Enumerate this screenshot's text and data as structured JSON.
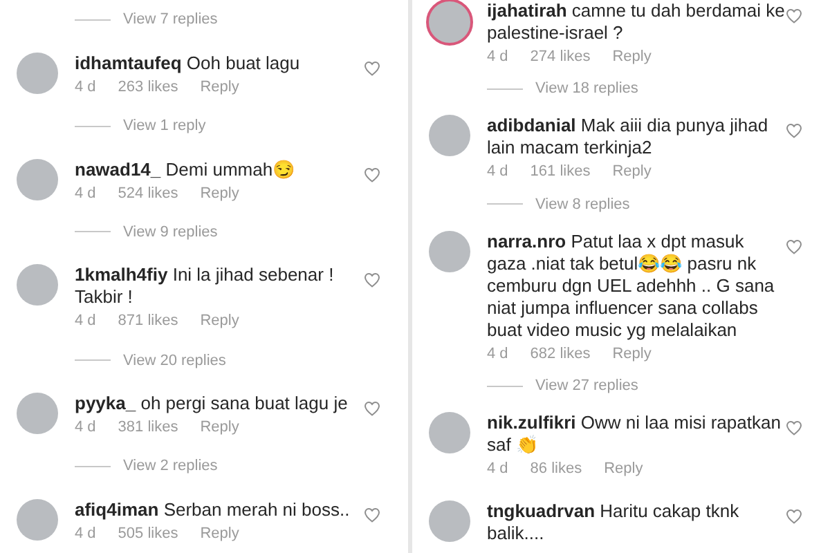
{
  "columns": [
    {
      "items": [
        {
          "kind": "replies",
          "label": "View 7 replies"
        },
        {
          "kind": "comment",
          "username": "idhamtaufeq",
          "text": "Ooh buat lagu",
          "time": "4 d",
          "likes": "263 likes",
          "reply": "Reply",
          "story_ring": false
        },
        {
          "kind": "replies",
          "label": "View 1 reply"
        },
        {
          "kind": "comment",
          "username": "nawad14_",
          "text": "Demi ummah😏",
          "time": "4 d",
          "likes": "524 likes",
          "reply": "Reply",
          "story_ring": false
        },
        {
          "kind": "replies",
          "label": "View 9 replies"
        },
        {
          "kind": "comment",
          "username": "1kmalh4fiy",
          "text": "Ini la jihad sebenar ! Takbir !",
          "time": "4 d",
          "likes": "871 likes",
          "reply": "Reply",
          "story_ring": false
        },
        {
          "kind": "replies",
          "label": "View 20 replies"
        },
        {
          "kind": "comment",
          "username": "pyyka_",
          "text": "oh pergi sana buat lagu je",
          "time": "4 d",
          "likes": "381 likes",
          "reply": "Reply",
          "story_ring": false
        },
        {
          "kind": "replies",
          "label": "View 2 replies"
        },
        {
          "kind": "comment",
          "username": "afiq4iman",
          "text": "Serban merah ni boss..",
          "time": "4 d",
          "likes": "505 likes",
          "reply": "Reply",
          "story_ring": false
        }
      ]
    },
    {
      "items": [
        {
          "kind": "comment",
          "username": "ijahatirah",
          "text": "camne tu dah berdamai ke palestine-israel ?",
          "time": "4 d",
          "likes": "274 likes",
          "reply": "Reply",
          "story_ring": true
        },
        {
          "kind": "replies",
          "label": "View 18 replies"
        },
        {
          "kind": "comment",
          "username": "adibdanial",
          "text": "Mak aiii dia punya jihad lain macam terkinja2",
          "time": "4 d",
          "likes": "161 likes",
          "reply": "Reply",
          "story_ring": false
        },
        {
          "kind": "replies",
          "label": "View 8 replies"
        },
        {
          "kind": "comment",
          "username": "narra.nro",
          "text": "Patut laa x dpt masuk gaza .niat tak betul😂😂 pasru nk cemburu dgn UEL  adehhh .. G sana niat jumpa influencer sana collabs buat video music yg melalaikan",
          "time": "4 d",
          "likes": "682 likes",
          "reply": "Reply",
          "story_ring": false
        },
        {
          "kind": "replies",
          "label": "View 27 replies"
        },
        {
          "kind": "comment",
          "username": "nik.zulfikri",
          "text": "Oww ni laa misi rapatkan saf 👏",
          "time": "4 d",
          "likes": "86 likes",
          "reply": "Reply",
          "story_ring": false
        },
        {
          "kind": "comment",
          "username": "tngkuadrvan",
          "text": "Haritu cakap tknk balik....",
          "story_ring": false
        }
      ]
    }
  ]
}
